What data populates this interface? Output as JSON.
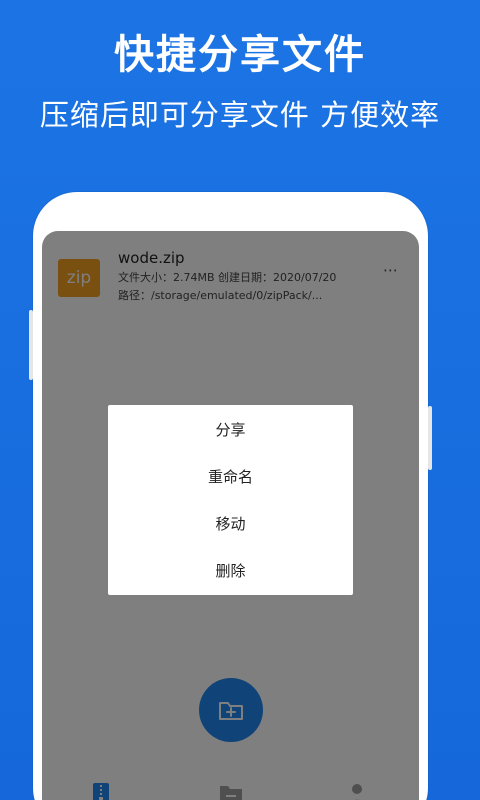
{
  "banner": {
    "title": "快捷分享文件",
    "subtitle": "压缩后即可分享文件 方便效率"
  },
  "file": {
    "icon_label": "zip",
    "name": "wode.zip",
    "meta": "文件大小：2.74MB   创建日期：2020/07/20",
    "path": "路径：/storage/emulated/0/zipPack/...",
    "more_icon": "⋯"
  },
  "dialog": {
    "items": [
      "分享",
      "重命名",
      "移动",
      "删除"
    ]
  },
  "icons": {
    "fab": "folder-add-icon",
    "nav": [
      "archive-icon",
      "folder-icon",
      "user-icon"
    ]
  },
  "colors": {
    "background": "#1c74e4",
    "accent": "#2187ee",
    "zip_icon": "#f2a01e"
  }
}
